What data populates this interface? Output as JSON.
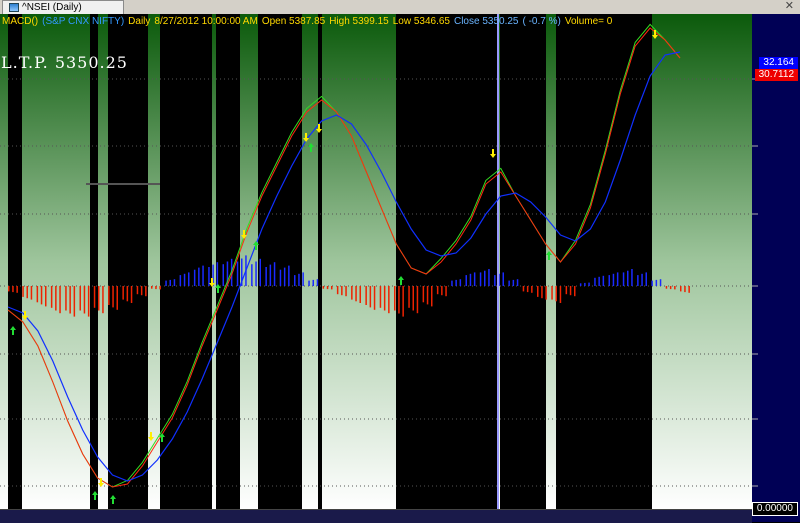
{
  "window": {
    "tab_title": "^NSEI (Daily)",
    "close_glyph": "✕",
    "tab_icon": "chart-icon"
  },
  "caption": {
    "formula": "MACD()",
    "symbol": "(S&P CNX NIFTY)",
    "period": "Daily",
    "datetime": "8/27/2012 10:00:00 AM",
    "open": "Open 5387.85",
    "high": "High 5399.15",
    "low": "Low 5346.65",
    "close": "Close 5350.25",
    "change": "( -0.7 %)",
    "volume": "Volume= 0"
  },
  "ltp": "L.T.P.  5350.25",
  "axis": {
    "macd_value": "32.164",
    "signal_value": "30.7112",
    "zero_value": "0.00000"
  },
  "colors": {
    "macd": "#1030ff",
    "signal": "#ff2a10",
    "bull_line": "#33dd22",
    "hist_pos": "#1a2aff",
    "hist_neg": "#ee2200",
    "up_arrow": "#22dd33",
    "down_arrow": "#ffee00",
    "axis_bg": "#000055",
    "cursor": "#9999ff"
  },
  "chart_data": {
    "type": "line",
    "series": [
      {
        "values": [
          -8,
          -12,
          -20,
          -32,
          -45,
          -56,
          -64,
          -67,
          -66,
          -60,
          -52,
          -44,
          -33,
          -20,
          -8,
          4,
          18,
          30,
          40,
          50,
          58,
          62,
          58,
          50,
          38,
          26,
          14,
          6,
          4,
          8,
          14,
          22,
          34,
          38,
          30,
          22,
          14,
          8,
          14,
          26,
          44,
          64,
          80,
          86,
          82,
          76
        ]
      },
      {
        "values": [
          -7,
          -9,
          -15,
          -25,
          -37,
          -48,
          -57,
          -63,
          -65,
          -63,
          -58,
          -51,
          -42,
          -31,
          -19,
          -7,
          6,
          19,
          30,
          40,
          49,
          55,
          57,
          54,
          47,
          38,
          28,
          19,
          12,
          10,
          11,
          16,
          24,
          30,
          31,
          28,
          23,
          17,
          15,
          19,
          28,
          42,
          57,
          70,
          77,
          78
        ]
      }
    ],
    "histogram": [
      -2,
      -4,
      -6,
      -8,
      -9,
      -9,
      -8,
      -7,
      -5,
      -3,
      -1,
      2,
      4,
      6,
      7,
      8,
      9,
      8,
      7,
      6,
      4,
      2,
      -1,
      -3,
      -5,
      -7,
      -8,
      -9,
      -8,
      -6,
      -3,
      2,
      4,
      5,
      4,
      2,
      -2,
      -4,
      -5,
      -3,
      1,
      3,
      4,
      5,
      4,
      2,
      -1,
      -2
    ]
  }
}
